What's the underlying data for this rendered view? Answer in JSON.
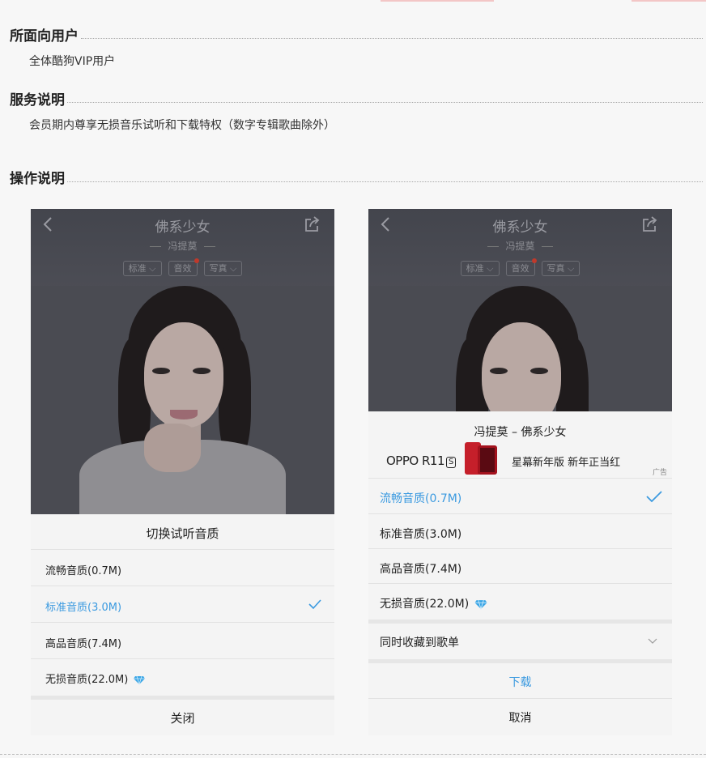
{
  "sections": [
    {
      "title": "所面向用户",
      "text": "全体酷狗VIP用户"
    },
    {
      "title": "服务说明",
      "text": "会员期内尊享无损音乐试听和下载特权（数字专辑歌曲除外）"
    },
    {
      "title": "操作说明",
      "text": ""
    }
  ],
  "player": {
    "song_title": "佛系少女",
    "artist": "冯提莫",
    "pills": [
      "标准",
      "音效",
      "写真"
    ]
  },
  "left_sheet": {
    "title": "切换试听音质",
    "options": [
      {
        "label": "流畅音质(0.7M)",
        "selected": false,
        "lossless": false
      },
      {
        "label": "标准音质(3.0M)",
        "selected": true,
        "lossless": false
      },
      {
        "label": "高品音质(7.4M)",
        "selected": false,
        "lossless": false
      },
      {
        "label": "无损音质(22.0M)",
        "selected": false,
        "lossless": true
      }
    ],
    "close_label": "关闭"
  },
  "right_sheet": {
    "title": "冯提莫 – 佛系少女",
    "ad": {
      "brand": "OPPO R11",
      "brand_badge": "S",
      "text": "星幕新年版  新年正当红",
      "tag": "广告"
    },
    "options": [
      {
        "label": "流畅音质(0.7M)",
        "selected": true,
        "lossless": false
      },
      {
        "label": "标准音质(3.0M)",
        "selected": false,
        "lossless": false
      },
      {
        "label": "高品音质(7.4M)",
        "selected": false,
        "lossless": false
      },
      {
        "label": "无损音质(22.0M)",
        "selected": false,
        "lossless": true
      }
    ],
    "playlist_label": "同时收藏到歌单",
    "download_label": "下载",
    "cancel_label": "取消"
  },
  "colors": {
    "accent": "#3b9ae0",
    "badge_dot": "#c0392b",
    "page_bg": "#f7f7f7"
  }
}
